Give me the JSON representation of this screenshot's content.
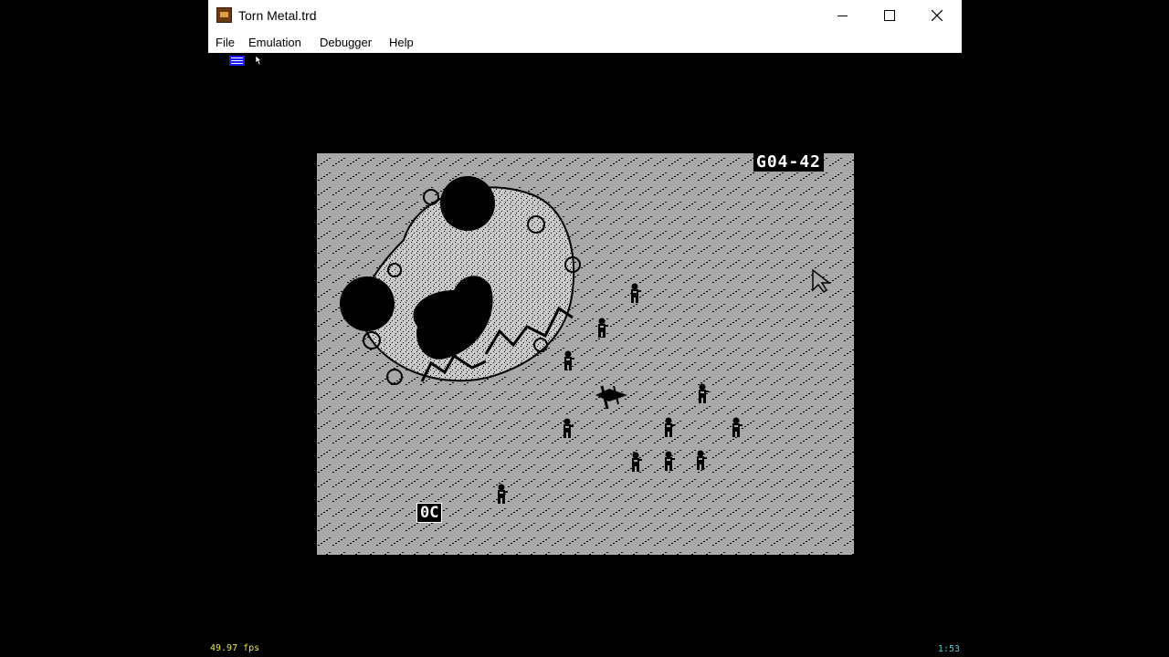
{
  "window": {
    "title": "Torn Metal.trd",
    "icon": "emulator-app-icon",
    "controls": [
      "minimize-icon",
      "maximize-icon",
      "close-icon"
    ]
  },
  "menu": {
    "items": [
      {
        "label": "File"
      },
      {
        "label": "Emulation"
      },
      {
        "label": "Debugger"
      },
      {
        "label": "Help"
      }
    ]
  },
  "emulator": {
    "indicators": [
      "disk-activity-icon",
      "mouse-capture-icon"
    ],
    "fps": "49.97 fps",
    "timer": "1:53"
  },
  "game": {
    "sector_code": "G04-42",
    "unit_counter": "0C",
    "colors": {
      "ground": "#a8a8a8",
      "ink": "#000000",
      "hud_text": "#ffffff"
    }
  }
}
